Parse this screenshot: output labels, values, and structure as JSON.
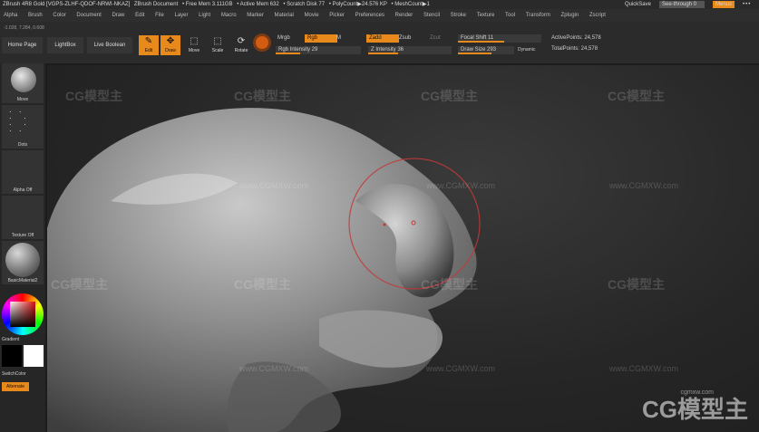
{
  "titlebar": {
    "app": "ZBrush 4R8 Gold [VGPS-ZLHF-QDOF-NRWI-NKAZ]",
    "document": "ZBrush Document",
    "free_mem": "• Free Mem 3.111GB",
    "active_mem": "• Active Mem 632",
    "scratch": "• Scratch Disk 77",
    "polycount": "• PolyCount▶24.576 KP",
    "meshcount": "• MeshCount▶1",
    "quicksave": "QuickSave",
    "see_through": "See-through 0",
    "menus": "Menus",
    "dots": "•••"
  },
  "menu": [
    "Alpha",
    "Brush",
    "Color",
    "Document",
    "Draw",
    "Edit",
    "File",
    "Layer",
    "Light",
    "Macro",
    "Marker",
    "Material",
    "Movie",
    "Picker",
    "Preferences",
    "Render",
    "Stencil",
    "Stroke",
    "Texture",
    "Tool",
    "Transform",
    "Zplugin",
    "Zscript"
  ],
  "toolbar": {
    "coords": "-1.028, 7.284, 0.608",
    "home": "Home Page",
    "lightbox": "LightBox",
    "live_boolean": "Live Boolean",
    "edit": "Edit",
    "draw": "Draw",
    "move": "Move",
    "scale": "Scale",
    "rotate": "Rotate",
    "mrgb": "Mrgb",
    "rgb": "Rgb",
    "m": "M",
    "rgb_intensity": "Rgb Intensity 29",
    "zadd": "Zadd",
    "zsub": "Zsub",
    "zcut": "Zcut",
    "z_intensity": "Z Intensity 36",
    "focal_shift": "Focal Shift 11",
    "draw_size": "Draw Size 293",
    "dynamic": "Dynamic",
    "active_points": "ActivePoints: 24,578",
    "total_points": "TotalPoints: 24,578",
    "rgb_intensity_level": 0.29,
    "z_intensity_level": 0.36,
    "focal_shift_level": 0.55,
    "draw_size_level": 0.6
  },
  "left": {
    "move": "Move",
    "dots": "Dots",
    "alpha": "Alpha Off",
    "texture": "Texture Off",
    "material": "BasicMaterial2",
    "gradient": "Gradient",
    "switch": "SwitchColor",
    "alternate": "Alternate"
  },
  "watermark": {
    "logo": "CG模型主",
    "url": "www.CGMXW.com",
    "big": "CG模型主",
    "big_url": "cgmxw.com"
  },
  "colors": {
    "accent": "#e8891c",
    "brush_ring": "#c23a3a"
  }
}
